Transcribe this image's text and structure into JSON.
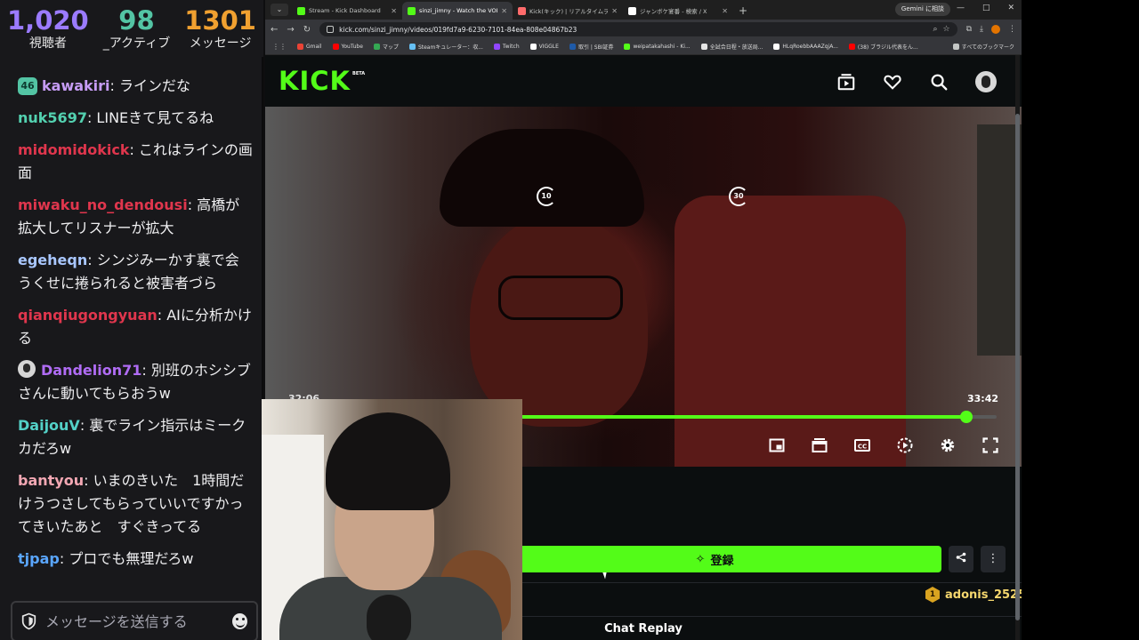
{
  "stats": {
    "viewers": {
      "value": "1,020",
      "label": "視聴者",
      "color": "#9b7bff"
    },
    "active": {
      "value": "98",
      "label": "_アクティブ",
      "color": "#53c4a4"
    },
    "messages": {
      "value": "1301",
      "label": "メッセージ",
      "color": "#f0a030"
    }
  },
  "chat": {
    "messages": [
      {
        "badge": "46",
        "user": "kawakiri",
        "color": "#c69cf5",
        "text": ": ラインだな"
      },
      {
        "user": "nuk5697",
        "color": "#53d1b0",
        "text": ": LINEきて見てるね"
      },
      {
        "user": "midomidokick",
        "color": "#e0364d",
        "text": ": これはラインの画面"
      },
      {
        "user": "miwaku_no_dendousi",
        "color": "#e0364d",
        "text": ": 高橋が拡大してリスナーが拡大"
      },
      {
        "user": "egeheqn",
        "color": "#a9c7ff",
        "text": ": シンジみーかす裏で会うくせに捲られると被害者づら"
      },
      {
        "user": "qianqiugongyuan",
        "color": "#e0364d",
        "text": ": AIに分析かける"
      },
      {
        "avatar": true,
        "user": "Dandelion71",
        "color": "#b06cf5",
        "text": ": 別班のホシシブさんに動いてもらおうw"
      },
      {
        "user": "DaijouV",
        "color": "#53d1c7",
        "text": ": 裏でライン指示はミークカだろw"
      },
      {
        "user": "bantyou",
        "color": "#f2a7b3",
        "text": ": いまのきいた　1時間だけうつさしてもらっていいですかってきいたあと　すぐきってる"
      },
      {
        "user": "tjpap",
        "color": "#5aa6ff",
        "text": ": プロでも無理だろw"
      }
    ],
    "input_placeholder": "メッセージを送信する",
    "shield_icon": "shield-icon",
    "emoji_icon": "emoji-icon"
  },
  "browser": {
    "tabs": [
      {
        "title": "Stream - Kick Dashboard",
        "fav": "#53fc18",
        "active": false
      },
      {
        "title": "sinzi_jimny - Watch the VOD on",
        "fav": "#53fc18",
        "active": true
      },
      {
        "title": "Kick(キック) | リアルタイムランキング",
        "fav": "#ff6b6b",
        "active": false
      },
      {
        "title": "ジャンボケ宴番 - 検索 / X",
        "fav": "#ffffff",
        "active": false
      }
    ],
    "gemini_label": "Gemini に相談",
    "url": "kick.com/sinzi_jimny/videos/019fd7a9-6230-7101-84ea-808e04867b23",
    "bookmarks": [
      {
        "label": "Gmail",
        "color": "#ea4335"
      },
      {
        "label": "YouTube",
        "color": "#ff0000"
      },
      {
        "label": "マップ",
        "color": "#34a853"
      },
      {
        "label": "Steamキュレーター：収...",
        "color": "#66c0f4"
      },
      {
        "label": "Twitch",
        "color": "#9146ff"
      },
      {
        "label": "VIGGLE",
        "color": "#ffffff"
      },
      {
        "label": "取引 | SBI証券",
        "color": "#1e5aa8"
      },
      {
        "label": "weipatakahashi - Ki...",
        "color": "#53fc18"
      },
      {
        "label": "全試合日程・放送局...",
        "color": "#e5e5e5"
      },
      {
        "label": "HLqRoebbAAAZqjA...",
        "color": "#ffffff"
      },
      {
        "label": "(38) ブラジル代表をん...",
        "color": "#ff0000"
      }
    ],
    "bookmarks_folder": "すべてのブックマーク"
  },
  "kick": {
    "logo": "KICK",
    "logo_sup": "BETA",
    "header_icons": [
      "video-library-icon",
      "heart-icon",
      "search-icon"
    ],
    "video": {
      "rewind_label": "10",
      "forward_label": "30",
      "current_time": "32:06",
      "duration": "33:42",
      "progress_fraction": 0.958,
      "controls": [
        "mini-player-icon",
        "theater-mode-icon",
        "captions-icon",
        "playback-speed-icon",
        "settings-icon",
        "fullscreen-icon"
      ]
    },
    "follow_label": "登録",
    "gift_user": "adonis_2525",
    "gift_badge": "1",
    "chat_replay": "Chat Replay",
    "accent": "#53fc18"
  }
}
